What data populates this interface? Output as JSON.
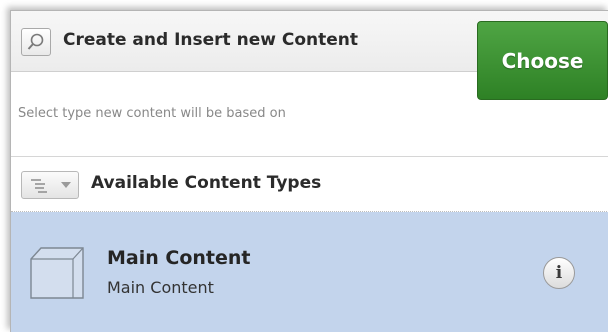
{
  "header": {
    "title": "Create and Insert new Content",
    "search_icon": "search-icon"
  },
  "selection": {
    "hint": "Select type new content will be based on",
    "choose_label": "Choose",
    "choose_color": "#3d9435"
  },
  "types_header": {
    "title": "Available Content Types",
    "toggle_icon": "list-dropdown-icon"
  },
  "content_types": [
    {
      "name": "Main Content",
      "description": "Main Content",
      "icon": "content-box-icon",
      "selected": true,
      "info_label": "i"
    }
  ],
  "colors": {
    "selected_row": "#c3d4ec"
  }
}
